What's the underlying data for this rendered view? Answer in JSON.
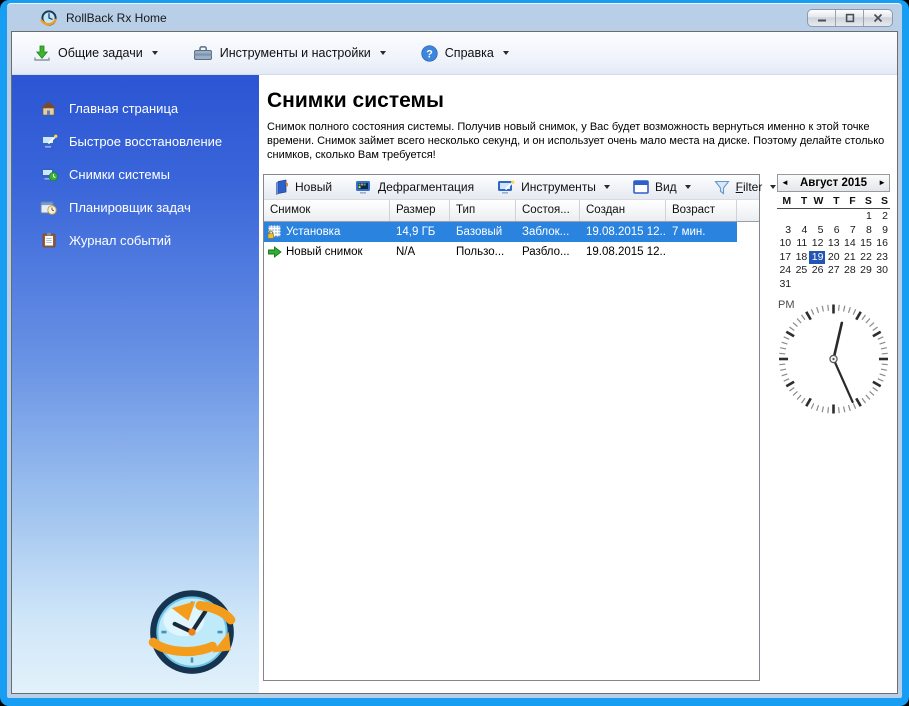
{
  "window": {
    "title": "RollBack Rx Home"
  },
  "colors": {
    "frame_blue": "#179df2",
    "titlebar": "#b9cfe8",
    "sidebar_top": "#2b55d3",
    "sidebar_bottom": "#e2f1fb",
    "row_selected": "#2b83e0",
    "calendar_selected": "#2356b4",
    "logo_orange": "#f49c1c"
  },
  "menubar": {
    "items": [
      {
        "label": "Общие задачи",
        "icon": "download-arrow",
        "dropdown": true
      },
      {
        "label": "Инструменты и настройки",
        "icon": "toolbox",
        "dropdown": true
      },
      {
        "label": "Справка",
        "icon": "help",
        "dropdown": true
      }
    ]
  },
  "sidebar": {
    "items": [
      {
        "label": "Главная страница",
        "icon": "home"
      },
      {
        "label": "Быстрое восстановление",
        "icon": "monitor-wand"
      },
      {
        "label": "Снимки системы",
        "icon": "monitor-clock"
      },
      {
        "label": "Планировщик задач",
        "icon": "scheduler"
      },
      {
        "label": "Журнал событий",
        "icon": "event-log"
      }
    ]
  },
  "main": {
    "title": "Снимки системы",
    "description": "Снимок полного состояния системы. Получив новый снимок, у Вас будет возможность вернуться именно к этой точке времени. Снимок займет всего несколько секунд, и он использует очень мало места на диске. Поэтому делайте столько снимков, сколько Вам требуется!",
    "toolbar": {
      "items": [
        {
          "label": "Новый",
          "icon": "new-snapshot-book",
          "dropdown": false
        },
        {
          "label": "Дефрагментация",
          "icon": "defrag-monitor",
          "dropdown": false
        },
        {
          "label": "Инструменты",
          "icon": "tools-monitor",
          "dropdown": true
        },
        {
          "label": "Вид",
          "icon": "view-window",
          "dropdown": true
        },
        {
          "label": "Filter",
          "icon": "filter-funnel",
          "dropdown": true
        }
      ]
    },
    "table": {
      "columns": [
        "Снимок",
        "Размер",
        "Тип",
        "Состоя...",
        "Создан",
        "Возраст"
      ],
      "rows": [
        {
          "icon": "base-snapshot-lock",
          "selected": true,
          "cells": [
            "Установка",
            "14,9 ГБ",
            "Базовый",
            "Заблок...",
            "19.08.2015 12...",
            "7 мин."
          ]
        },
        {
          "icon": "new-snapshot-arrow",
          "selected": false,
          "cells": [
            "Новый снимок",
            "N/A",
            "Пользо...",
            "Разбло...",
            "19.08.2015 12...",
            ""
          ]
        }
      ]
    }
  },
  "calendar": {
    "month_label": "Август 2015",
    "prev_icon": "◄",
    "next_icon": "►",
    "weekdays": [
      "M",
      "T",
      "W",
      "T",
      "F",
      "S",
      "S"
    ],
    "weeks": [
      [
        "",
        "",
        "",
        "",
        "",
        "1",
        "2"
      ],
      [
        "3",
        "4",
        "5",
        "6",
        "7",
        "8",
        "9"
      ],
      [
        "10",
        "11",
        "12",
        "13",
        "14",
        "15",
        "16"
      ],
      [
        "17",
        "18",
        "19",
        "20",
        "21",
        "22",
        "23"
      ],
      [
        "24",
        "25",
        "26",
        "27",
        "28",
        "29",
        "30"
      ],
      [
        "31",
        "",
        "",
        "",
        "",
        "",
        ""
      ]
    ],
    "selected_day": "19"
  },
  "clock": {
    "meridiem": "PM",
    "time": "12:26"
  }
}
